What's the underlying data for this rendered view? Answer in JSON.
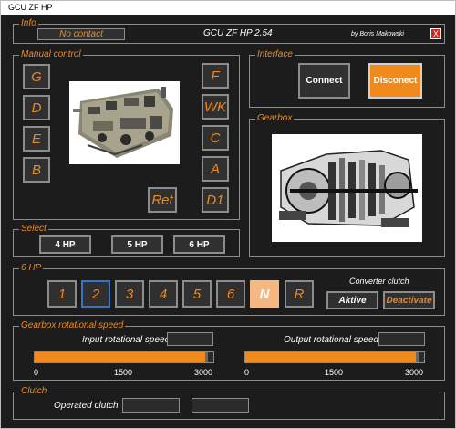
{
  "window": {
    "title": "GCU ZF HP"
  },
  "info": {
    "label": "Info",
    "status": "No contact",
    "app_name": "GCU ZF HP  2.54",
    "author": "by Boris Makowski",
    "close_label": "X"
  },
  "manual_control": {
    "label": "Manual control",
    "left_buttons": [
      "G",
      "D",
      "E",
      "B"
    ],
    "right_buttons": [
      "F",
      "WK",
      "C",
      "A",
      "D1"
    ],
    "ret_label": "Ret"
  },
  "interface": {
    "label": "Interface",
    "connect": "Connect",
    "disconnect": "Disconect"
  },
  "gearbox": {
    "label": "Gearbox"
  },
  "select": {
    "label": "Select",
    "buttons": [
      "4 HP",
      "5 HP",
      "6 HP"
    ]
  },
  "hp6": {
    "label": "6 HP",
    "gears": [
      "1",
      "2",
      "3",
      "4",
      "5",
      "6",
      "N",
      "R"
    ],
    "selected_gear": "2",
    "active_gear": "N",
    "converter_label": "Converter clutch",
    "aktive": "Aktive",
    "deactivate": "Deactivate"
  },
  "speed": {
    "label": "Gearbox rotational speed",
    "input_label": "Input rotational speed",
    "output_label": "Output rotational speed",
    "input_fraction": 0.97,
    "output_fraction": 0.97,
    "scale": [
      "0",
      "1500",
      "3000"
    ]
  },
  "clutch": {
    "label": "Clutch",
    "operated_label": "Operated clutch"
  },
  "colors": {
    "accent": "#f08a1c",
    "text_accent": "#e88a2a",
    "background": "#1c1c1c"
  }
}
